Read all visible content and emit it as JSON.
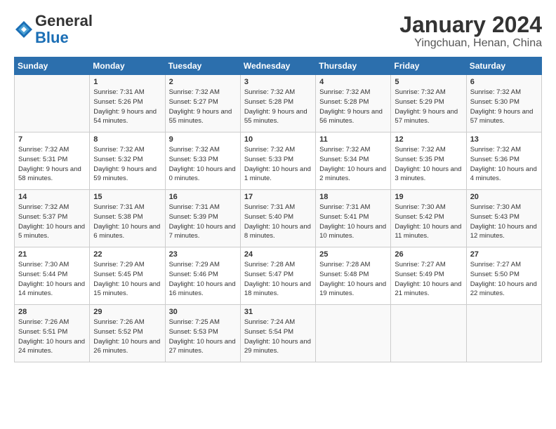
{
  "header": {
    "logo_general": "General",
    "logo_blue": "Blue",
    "title": "January 2024",
    "subtitle": "Yingchuan, Henan, China"
  },
  "columns": [
    "Sunday",
    "Monday",
    "Tuesday",
    "Wednesday",
    "Thursday",
    "Friday",
    "Saturday"
  ],
  "weeks": [
    [
      {
        "day": "",
        "sunrise": "",
        "sunset": "",
        "daylight": ""
      },
      {
        "day": "1",
        "sunrise": "Sunrise: 7:31 AM",
        "sunset": "Sunset: 5:26 PM",
        "daylight": "Daylight: 9 hours and 54 minutes."
      },
      {
        "day": "2",
        "sunrise": "Sunrise: 7:32 AM",
        "sunset": "Sunset: 5:27 PM",
        "daylight": "Daylight: 9 hours and 55 minutes."
      },
      {
        "day": "3",
        "sunrise": "Sunrise: 7:32 AM",
        "sunset": "Sunset: 5:28 PM",
        "daylight": "Daylight: 9 hours and 55 minutes."
      },
      {
        "day": "4",
        "sunrise": "Sunrise: 7:32 AM",
        "sunset": "Sunset: 5:28 PM",
        "daylight": "Daylight: 9 hours and 56 minutes."
      },
      {
        "day": "5",
        "sunrise": "Sunrise: 7:32 AM",
        "sunset": "Sunset: 5:29 PM",
        "daylight": "Daylight: 9 hours and 57 minutes."
      },
      {
        "day": "6",
        "sunrise": "Sunrise: 7:32 AM",
        "sunset": "Sunset: 5:30 PM",
        "daylight": "Daylight: 9 hours and 57 minutes."
      }
    ],
    [
      {
        "day": "7",
        "sunrise": "Sunrise: 7:32 AM",
        "sunset": "Sunset: 5:31 PM",
        "daylight": "Daylight: 9 hours and 58 minutes."
      },
      {
        "day": "8",
        "sunrise": "Sunrise: 7:32 AM",
        "sunset": "Sunset: 5:32 PM",
        "daylight": "Daylight: 9 hours and 59 minutes."
      },
      {
        "day": "9",
        "sunrise": "Sunrise: 7:32 AM",
        "sunset": "Sunset: 5:33 PM",
        "daylight": "Daylight: 10 hours and 0 minutes."
      },
      {
        "day": "10",
        "sunrise": "Sunrise: 7:32 AM",
        "sunset": "Sunset: 5:33 PM",
        "daylight": "Daylight: 10 hours and 1 minute."
      },
      {
        "day": "11",
        "sunrise": "Sunrise: 7:32 AM",
        "sunset": "Sunset: 5:34 PM",
        "daylight": "Daylight: 10 hours and 2 minutes."
      },
      {
        "day": "12",
        "sunrise": "Sunrise: 7:32 AM",
        "sunset": "Sunset: 5:35 PM",
        "daylight": "Daylight: 10 hours and 3 minutes."
      },
      {
        "day": "13",
        "sunrise": "Sunrise: 7:32 AM",
        "sunset": "Sunset: 5:36 PM",
        "daylight": "Daylight: 10 hours and 4 minutes."
      }
    ],
    [
      {
        "day": "14",
        "sunrise": "Sunrise: 7:32 AM",
        "sunset": "Sunset: 5:37 PM",
        "daylight": "Daylight: 10 hours and 5 minutes."
      },
      {
        "day": "15",
        "sunrise": "Sunrise: 7:31 AM",
        "sunset": "Sunset: 5:38 PM",
        "daylight": "Daylight: 10 hours and 6 minutes."
      },
      {
        "day": "16",
        "sunrise": "Sunrise: 7:31 AM",
        "sunset": "Sunset: 5:39 PM",
        "daylight": "Daylight: 10 hours and 7 minutes."
      },
      {
        "day": "17",
        "sunrise": "Sunrise: 7:31 AM",
        "sunset": "Sunset: 5:40 PM",
        "daylight": "Daylight: 10 hours and 8 minutes."
      },
      {
        "day": "18",
        "sunrise": "Sunrise: 7:31 AM",
        "sunset": "Sunset: 5:41 PM",
        "daylight": "Daylight: 10 hours and 10 minutes."
      },
      {
        "day": "19",
        "sunrise": "Sunrise: 7:30 AM",
        "sunset": "Sunset: 5:42 PM",
        "daylight": "Daylight: 10 hours and 11 minutes."
      },
      {
        "day": "20",
        "sunrise": "Sunrise: 7:30 AM",
        "sunset": "Sunset: 5:43 PM",
        "daylight": "Daylight: 10 hours and 12 minutes."
      }
    ],
    [
      {
        "day": "21",
        "sunrise": "Sunrise: 7:30 AM",
        "sunset": "Sunset: 5:44 PM",
        "daylight": "Daylight: 10 hours and 14 minutes."
      },
      {
        "day": "22",
        "sunrise": "Sunrise: 7:29 AM",
        "sunset": "Sunset: 5:45 PM",
        "daylight": "Daylight: 10 hours and 15 minutes."
      },
      {
        "day": "23",
        "sunrise": "Sunrise: 7:29 AM",
        "sunset": "Sunset: 5:46 PM",
        "daylight": "Daylight: 10 hours and 16 minutes."
      },
      {
        "day": "24",
        "sunrise": "Sunrise: 7:28 AM",
        "sunset": "Sunset: 5:47 PM",
        "daylight": "Daylight: 10 hours and 18 minutes."
      },
      {
        "day": "25",
        "sunrise": "Sunrise: 7:28 AM",
        "sunset": "Sunset: 5:48 PM",
        "daylight": "Daylight: 10 hours and 19 minutes."
      },
      {
        "day": "26",
        "sunrise": "Sunrise: 7:27 AM",
        "sunset": "Sunset: 5:49 PM",
        "daylight": "Daylight: 10 hours and 21 minutes."
      },
      {
        "day": "27",
        "sunrise": "Sunrise: 7:27 AM",
        "sunset": "Sunset: 5:50 PM",
        "daylight": "Daylight: 10 hours and 22 minutes."
      }
    ],
    [
      {
        "day": "28",
        "sunrise": "Sunrise: 7:26 AM",
        "sunset": "Sunset: 5:51 PM",
        "daylight": "Daylight: 10 hours and 24 minutes."
      },
      {
        "day": "29",
        "sunrise": "Sunrise: 7:26 AM",
        "sunset": "Sunset: 5:52 PM",
        "daylight": "Daylight: 10 hours and 26 minutes."
      },
      {
        "day": "30",
        "sunrise": "Sunrise: 7:25 AM",
        "sunset": "Sunset: 5:53 PM",
        "daylight": "Daylight: 10 hours and 27 minutes."
      },
      {
        "day": "31",
        "sunrise": "Sunrise: 7:24 AM",
        "sunset": "Sunset: 5:54 PM",
        "daylight": "Daylight: 10 hours and 29 minutes."
      },
      {
        "day": "",
        "sunrise": "",
        "sunset": "",
        "daylight": ""
      },
      {
        "day": "",
        "sunrise": "",
        "sunset": "",
        "daylight": ""
      },
      {
        "day": "",
        "sunrise": "",
        "sunset": "",
        "daylight": ""
      }
    ]
  ]
}
